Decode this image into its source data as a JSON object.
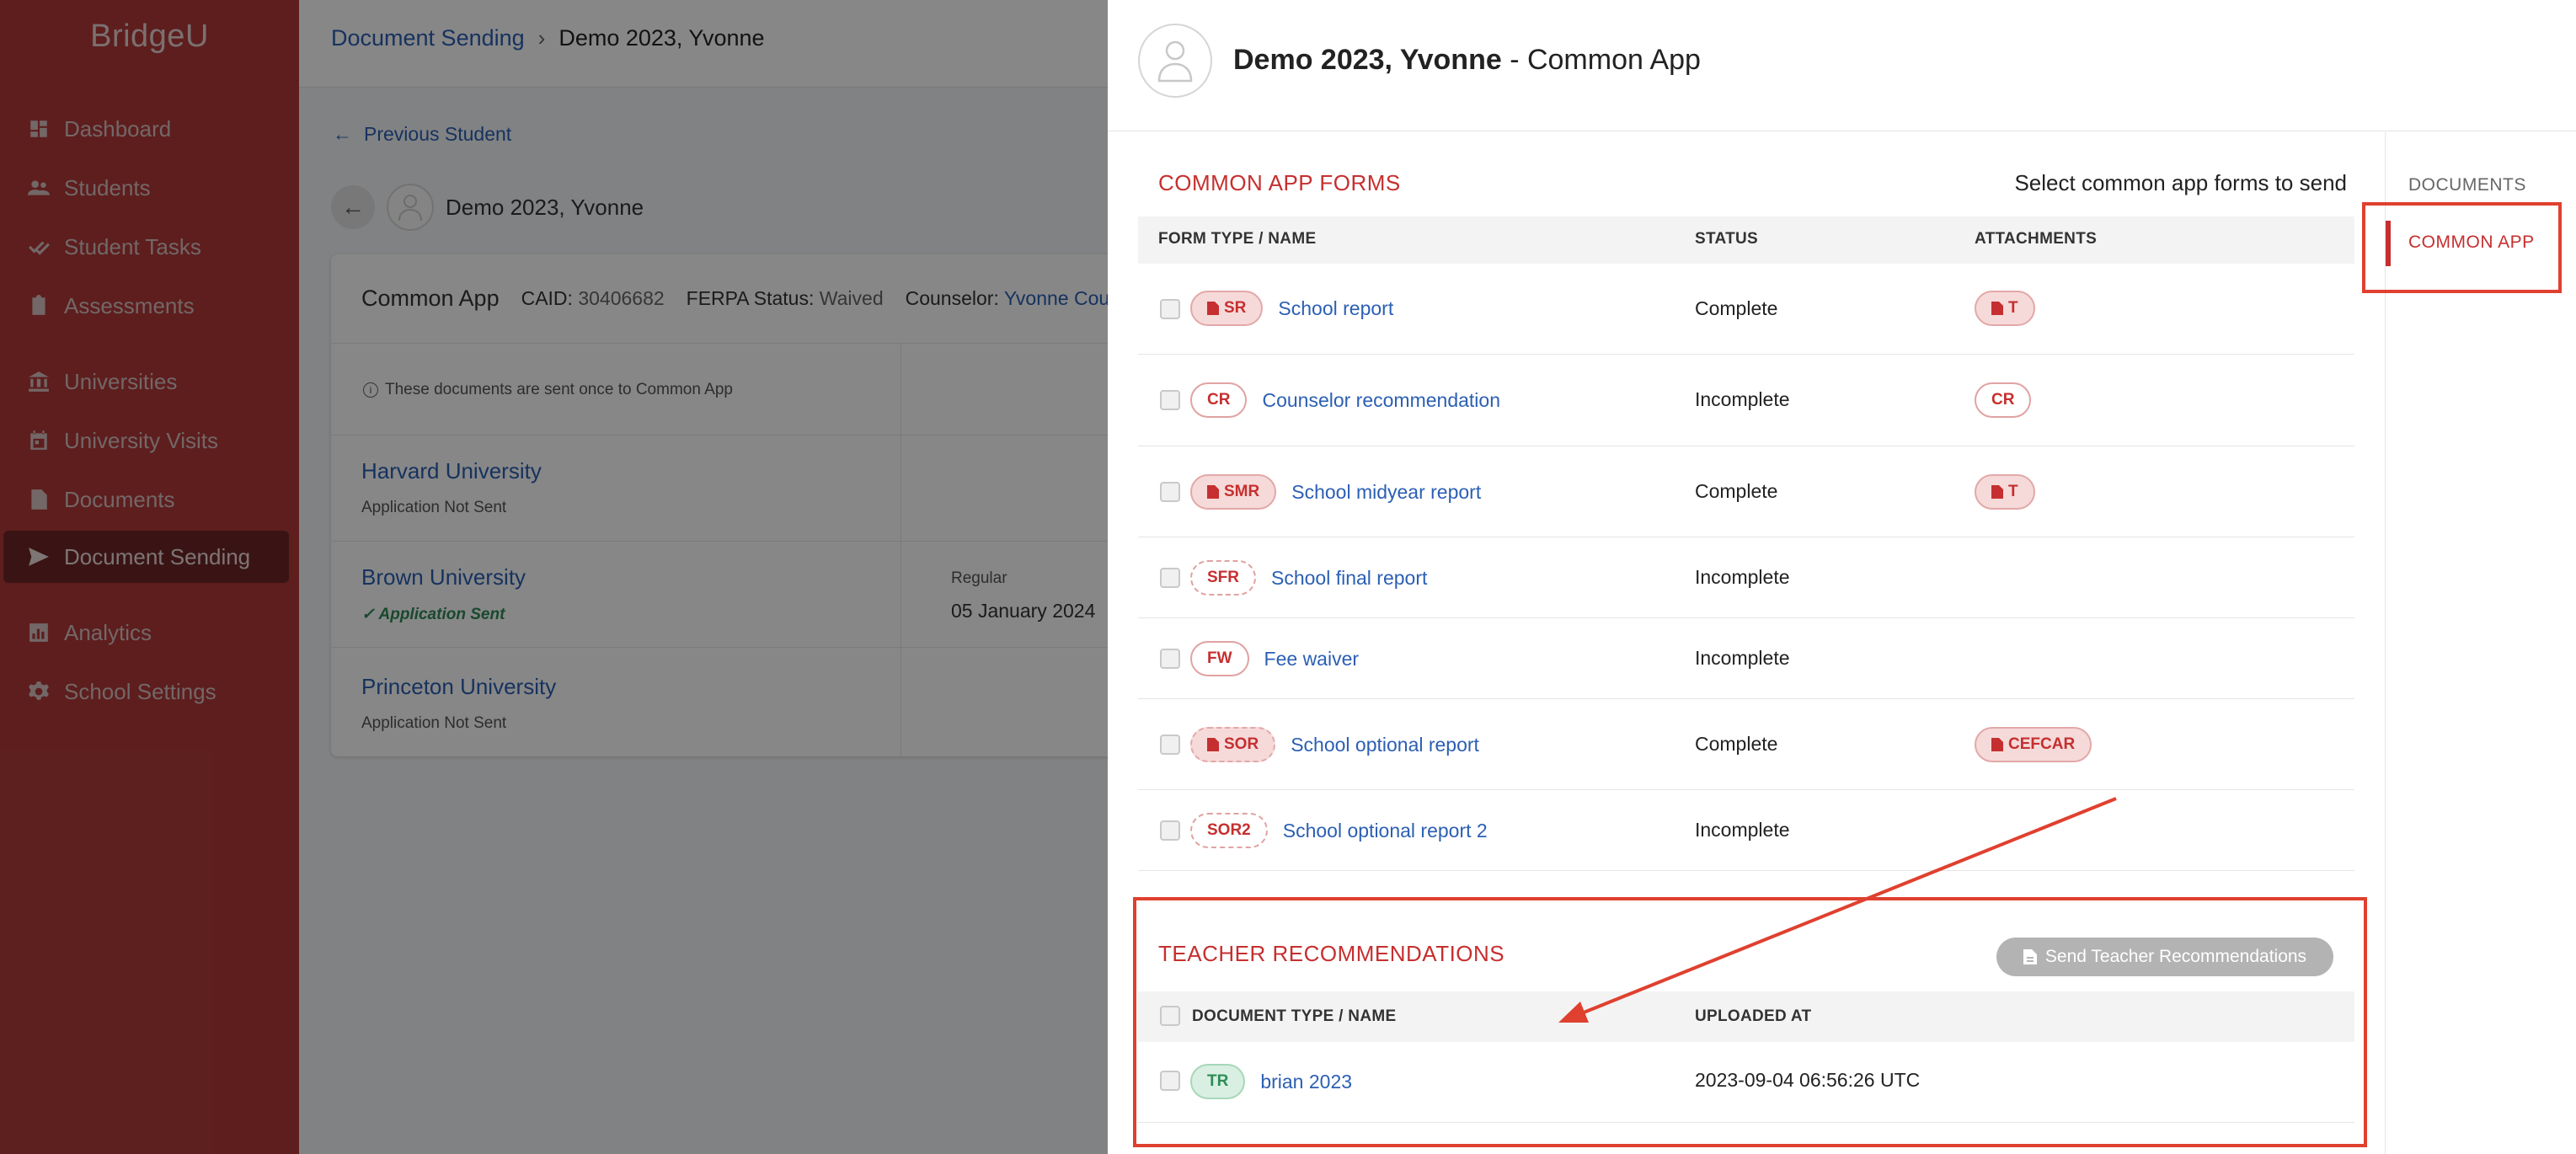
{
  "app": {
    "logo": "BridgeU"
  },
  "sidebar": {
    "items": [
      {
        "label": "Dashboard",
        "icon": "dashboard-icon"
      },
      {
        "label": "Students",
        "icon": "users-icon"
      },
      {
        "label": "Student Tasks",
        "icon": "checkmarks-icon"
      },
      {
        "label": "Assessments",
        "icon": "clipboard-icon"
      },
      {
        "label": "Universities",
        "icon": "university-icon"
      },
      {
        "label": "University Visits",
        "icon": "calendar-icon"
      },
      {
        "label": "Documents",
        "icon": "document-icon"
      },
      {
        "label": "Document Sending",
        "icon": "send-icon",
        "active": true
      },
      {
        "label": "Analytics",
        "icon": "bar-chart-icon"
      },
      {
        "label": "School Settings",
        "icon": "gear-icon"
      }
    ]
  },
  "background": {
    "breadcrumb": {
      "root": "Document Sending",
      "current": "Demo 2023, Yvonne"
    },
    "previous_student": "Previous Student",
    "student_name": "Demo 2023, Yvonne",
    "card": {
      "title": "Common App",
      "caid_label": "CAID:",
      "caid_value": "30406682",
      "ferpa_label": "FERPA Status:",
      "ferpa_value": "Waived",
      "counselor_label": "Counselor:",
      "counselor_value": "Yvonne Counse",
      "note": "These documents are sent once to Common App",
      "universities": [
        {
          "name": "Harvard University",
          "status": "Application Not Sent"
        },
        {
          "name": "Brown University",
          "status": "Application Sent",
          "deadline_type": "Regular",
          "deadline_date": "05 January 2024"
        },
        {
          "name": "Princeton University",
          "status": "Application Not Sent"
        }
      ]
    }
  },
  "drawer": {
    "title_name": "Demo 2023, Yvonne",
    "title_suffix": " - Common App",
    "right_nav": {
      "documents": "DOCUMENTS",
      "common_app": "COMMON APP"
    },
    "forms": {
      "section_title": "COMMON APP FORMS",
      "section_hint": "Select common app forms to send",
      "headers": {
        "type": "FORM TYPE / NAME",
        "status": "STATUS",
        "attachments": "ATTACHMENTS"
      },
      "rows": [
        {
          "code": "SR",
          "name": "School report",
          "status": "Complete",
          "attachment": "T",
          "style": "filled",
          "att_style": "filled"
        },
        {
          "code": "CR",
          "name": "Counselor recommendation",
          "status": "Incomplete",
          "attachment": "CR",
          "style": "outline",
          "att_style": "outline"
        },
        {
          "code": "SMR",
          "name": "School midyear report",
          "status": "Complete",
          "attachment": "T",
          "style": "filled",
          "att_style": "filled"
        },
        {
          "code": "SFR",
          "name": "School final report",
          "status": "Incomplete",
          "attachment": "",
          "style": "dashed"
        },
        {
          "code": "FW",
          "name": "Fee waiver",
          "status": "Incomplete",
          "attachment": "",
          "style": "outline"
        },
        {
          "code": "SOR",
          "name": "School optional report",
          "status": "Complete",
          "attachment": "CEFCAR",
          "style": "filled-dashed",
          "att_style": "filled"
        },
        {
          "code": "SOR2",
          "name": "School optional report 2",
          "status": "Incomplete",
          "attachment": "",
          "style": "dashed"
        }
      ]
    },
    "teacher": {
      "section_title": "TEACHER RECOMMENDATIONS",
      "send_button": "Send Teacher Recommendations",
      "headers": {
        "type": "DOCUMENT TYPE / NAME",
        "uploaded": "UPLOADED AT"
      },
      "rows": [
        {
          "code": "TR",
          "name": "brian 2023",
          "uploaded_at": "2023-09-04 06:56:26 UTC"
        }
      ]
    }
  },
  "colors": {
    "brand_red": "#b23a3a",
    "accent_red": "#c62f2f",
    "link_blue": "#2b5fb3",
    "annotation_red": "#e0402f"
  }
}
